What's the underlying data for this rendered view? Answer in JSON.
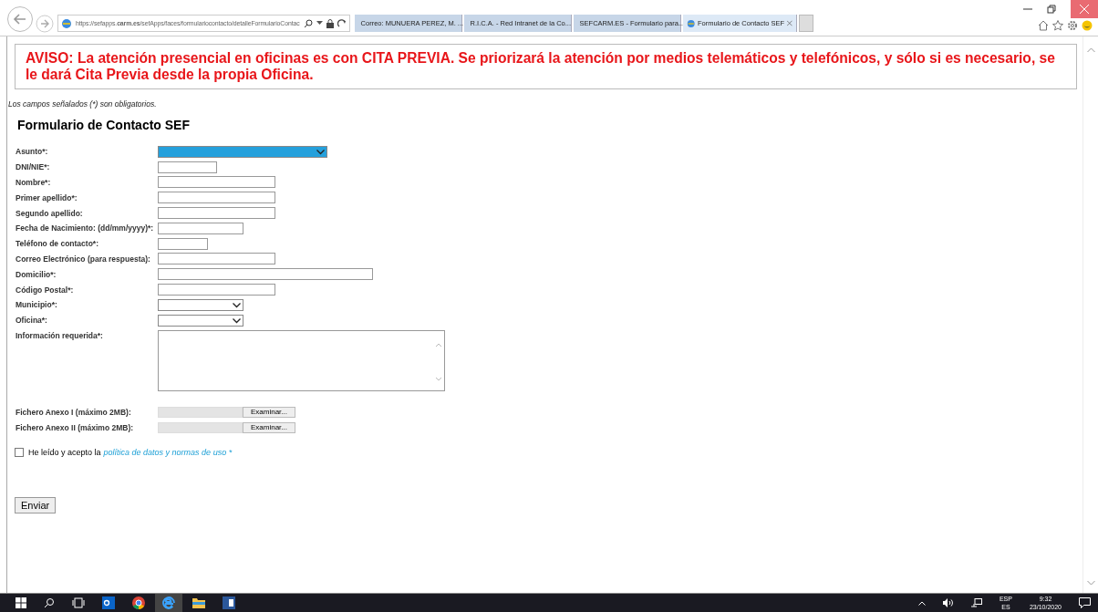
{
  "browser": {
    "url": "https://sefapps.**carm.es**/sefApps/faces/formulariocontacto/detalleFormularioContac",
    "tabs": [
      {
        "title": "Correo: MUNUERA PEREZ, M. ...",
        "selected": false,
        "kind": "mail"
      },
      {
        "title": "R.I.C.A. - Red Intranet de la Co...",
        "selected": false,
        "kind": "rica"
      },
      {
        "title": "SEFCARM.ES - Formulario para...",
        "selected": false,
        "kind": "sef"
      },
      {
        "title": "Formulario de Contacto SEF",
        "selected": true,
        "kind": "ie"
      }
    ]
  },
  "notice": "AVISO: La atención presencial en oficinas es con CITA PREVIA. Se priorizará la atención por medios telemáticos y telefónicos, y sólo si es necesario, se le dará Cita Previa desde la propia Oficina.",
  "required_note": "Los campos señalados (*) son obligatorios.",
  "form": {
    "title": "Formulario de Contacto SEF",
    "fields": [
      {
        "label": "Asunto*:",
        "kind": "select",
        "highlighted": true
      },
      {
        "label": "DNI/NIE*:",
        "kind": "text"
      },
      {
        "label": "Nombre*:",
        "kind": "text"
      },
      {
        "label": "Primer apellido*:",
        "kind": "text"
      },
      {
        "label": "Segundo apellido:",
        "kind": "text"
      },
      {
        "label": "Fecha de Nacimiento: (dd/mm/yyyy)*:",
        "kind": "text"
      },
      {
        "label": "Teléfono de contacto*:",
        "kind": "text"
      },
      {
        "label": "Correo Electrónico (para respuesta):",
        "kind": "text"
      },
      {
        "label": "Domicilio*:",
        "kind": "text"
      },
      {
        "label": "Código Postal*:",
        "kind": "text"
      },
      {
        "label": "Municipio*:",
        "kind": "select",
        "highlighted": false
      },
      {
        "label": "Oficina*:",
        "kind": "select",
        "highlighted": false
      },
      {
        "label": "Información requerida*:",
        "kind": "textarea"
      }
    ],
    "files": [
      {
        "label": "Fichero Anexo I (máximo 2MB):",
        "button": "Examinar..."
      },
      {
        "label": "Fichero Anexo II (máximo 2MB):",
        "button": "Examinar..."
      }
    ],
    "consent": {
      "text": "He leído y acepto la",
      "link": "política de datos y normas de uso *",
      "checked": false
    },
    "submit": "Enviar"
  },
  "taskbar": {
    "language": "ESP",
    "layout": "ES",
    "time": "9:32",
    "date": "23/10/2020"
  }
}
